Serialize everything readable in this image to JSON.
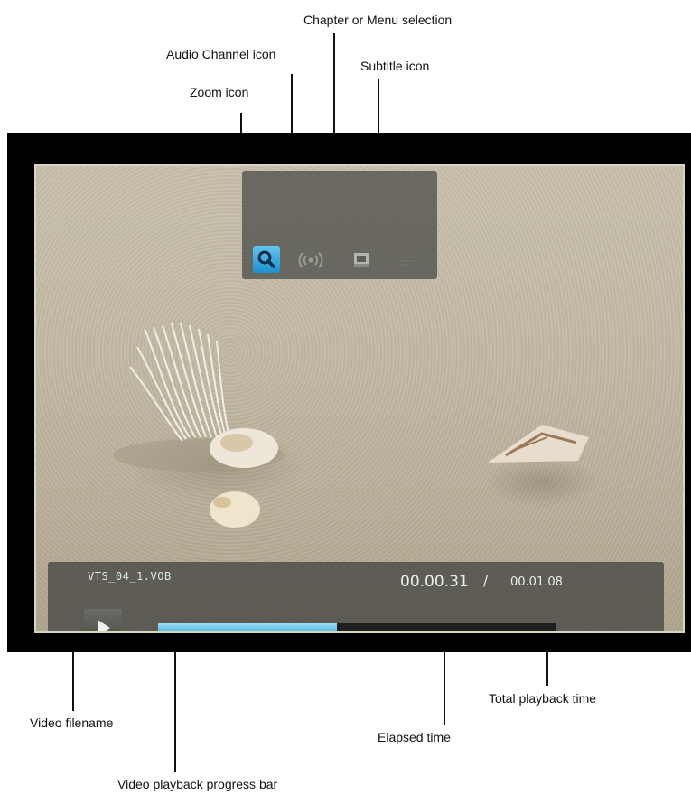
{
  "callouts": {
    "chapter_menu": "Chapter or Menu selection",
    "audio_channel": "Audio Channel icon",
    "subtitle": "Subtitle icon",
    "zoom": "Zoom icon",
    "video_filename": "Video filename",
    "total_playback_time": "Total playback time",
    "elapsed_time": "Elapsed time",
    "progress_bar": "Video playback progress bar"
  },
  "player": {
    "filename": "VTS_04_1.VOB",
    "elapsed": "00.00.31",
    "separator": "/",
    "total": "00.01.08",
    "progress_fraction": 0.45,
    "icons": [
      "zoom-icon",
      "audio-channel-icon",
      "chapter-menu-icon",
      "subtitle-icon"
    ],
    "play_state": "play-icon"
  },
  "colors": {
    "accent": "#3eb1e0",
    "zoom_selected": "#2a9ad8",
    "panel": "#55554f",
    "background": "#ffffff"
  }
}
